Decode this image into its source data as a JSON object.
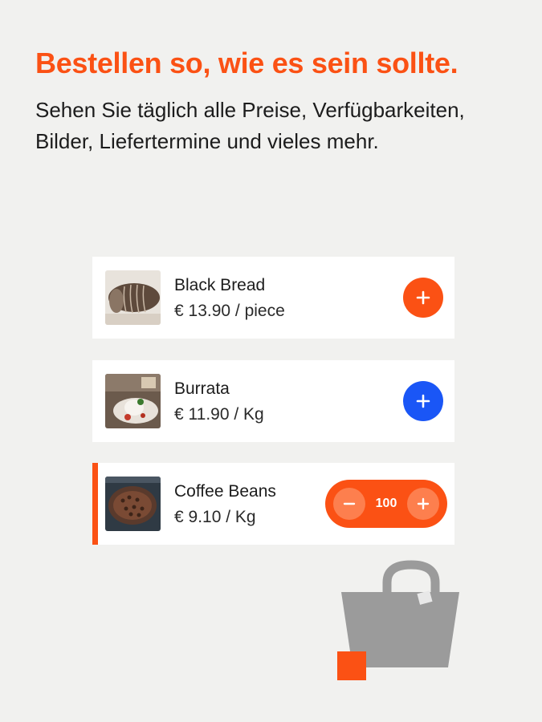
{
  "header": {
    "headline": "Bestellen so, wie es sein sollte.",
    "subline": "Sehen Sie täglich alle Preise, Verfügbarkeiten, Bilder, Liefertermine und vieles mehr."
  },
  "products": [
    {
      "name": "Black Bread",
      "price": "€ 13.90 / piece",
      "image": "bread-photo",
      "button_color": "#fb5114"
    },
    {
      "name": "Burrata",
      "price": "€ 11.90 / Kg",
      "image": "burrata-photo",
      "button_color": "#1a56f6"
    },
    {
      "name": "Coffee Beans",
      "price": "€ 9.10 / Kg",
      "image": "coffee-beans-photo",
      "quantity": "100"
    }
  ],
  "colors": {
    "accent": "#fb5114",
    "blue": "#1a56f6",
    "background": "#f1f1ef",
    "bag": "#9b9b9b"
  },
  "icons": {
    "add": "plus-icon",
    "decrease": "minus-icon",
    "bag": "shopping-bag-icon"
  }
}
